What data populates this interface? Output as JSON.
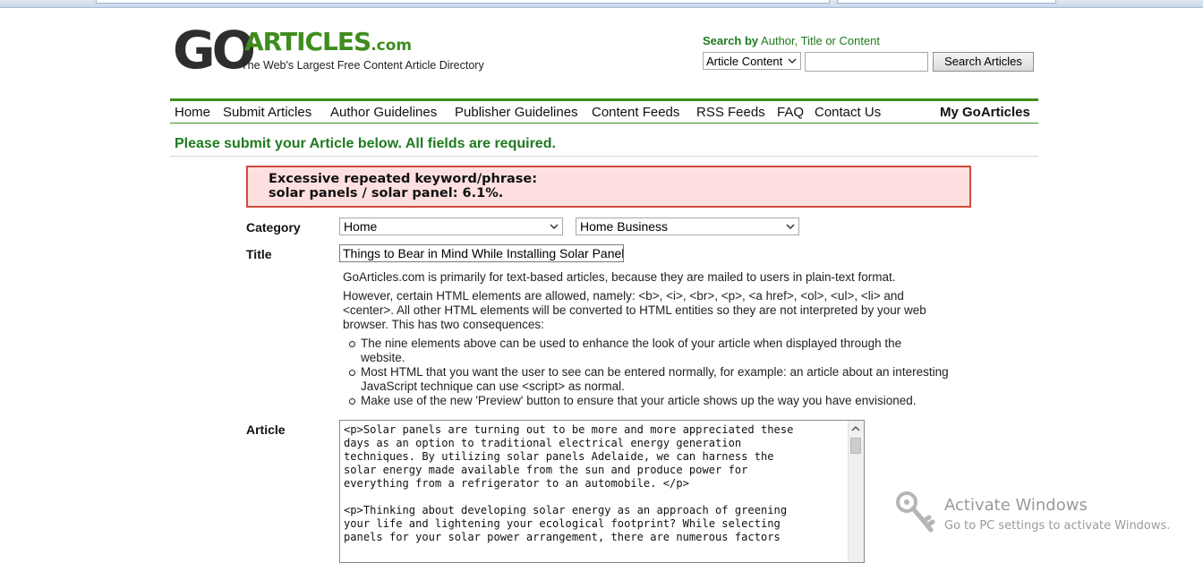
{
  "logo": {
    "go": "GO",
    "articles": "ARTICLES",
    "com": ".com",
    "tagline": "The Web's Largest Free Content Article Directory"
  },
  "search": {
    "label_bold": "Search by",
    "label_rest": " Author, Title or Content",
    "select_value": "Article Content",
    "input_value": "",
    "button_label": "Search Articles"
  },
  "nav": {
    "items": [
      "Home",
      "Submit Articles",
      "Author Guidelines",
      "Publisher Guidelines",
      "Content Feeds",
      "RSS Feeds",
      "FAQ",
      "Contact Us"
    ],
    "my": "My GoArticles"
  },
  "intro": "Please submit your Article below. All fields are required.",
  "error": {
    "line1": "Excessive repeated keyword/phrase:",
    "line2": "solar panels / solar panel: 6.1%."
  },
  "form": {
    "category_label": "Category",
    "category_value": "Home",
    "subcategory_value": "Home Business",
    "title_label": "Title",
    "title_value": "Things to Bear in Mind While Installing Solar Panel Ac",
    "article_label": "Article"
  },
  "info": {
    "p1": "GoArticles.com is primarily for text-based articles, because they are mailed to users in plain-text format.",
    "p2": "However, certain HTML elements are allowed, namely: <b>, <i>, <br>, <p>, <a href>, <ol>, <ul>, <li> and <center>. All other HTML elements will be converted to HTML entities so they are not interpreted by your web browser. This has two consequences:",
    "bullets": [
      "The nine elements above can be used to enhance the look of your article when displayed through the website.",
      "Most HTML that you want the user to see can be entered normally, for example: an article about an interesting JavaScript technique can use <script> as normal.",
      "Make use of the new 'Preview' button to ensure that your article shows up the way you have envisioned."
    ]
  },
  "article_text": "<p>Solar panels are turning out to be more and more appreciated these\ndays as an option to traditional electrical energy generation\ntechniques. By utilizing solar panels Adelaide, we can harness the\nsolar energy made available from the sun and produce power for\neverything from a refrigerator to an automobile. </p>\n\n<p>Thinking about developing solar energy as an approach of greening\nyour life and lightening your ecological footprint? While selecting\npanels for your solar power arrangement, there are numerous factors",
  "watermark": {
    "title": "Activate Windows",
    "subtitle": "Go to PC settings to activate Windows."
  }
}
